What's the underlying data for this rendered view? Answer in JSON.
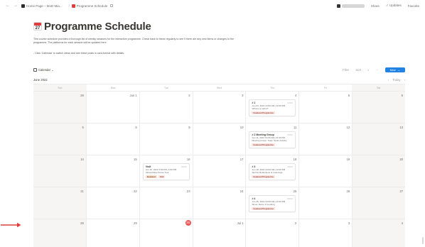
{
  "topbar": {
    "back": "←",
    "forward": "→",
    "crumbs": [
      {
        "label": "Home Page – MoD Mia...",
        "icon_color": "#2b2b2b"
      },
      {
        "label": "Programme Schedule",
        "icon_color": "#e03e3e"
      }
    ],
    "share": "Share",
    "updates": "✓ Updates",
    "favorite": "Favorite"
  },
  "page": {
    "title": "Programme Schedule",
    "icon_day": "27",
    "description": "This course schedule provides a thorough list of weekly sessions for the interactive programme. Check back to these regularly to see if there are any new items or changes to the programme. The platforms for each session will be updated here.",
    "tip": "- Click 'Calendar' to switch views and see these posts in card-format with details."
  },
  "view": {
    "tab_label": "Calendar ⌄",
    "filter": "Filter",
    "sort": "Sort",
    "search": "⌕",
    "more": "···",
    "new_button": "New",
    "new_chevron": "⌄"
  },
  "calendar": {
    "month_label": "June 2022",
    "prev": "‹",
    "today": "Today",
    "next": "›",
    "weekdays": [
      "Sun",
      "Mon",
      "Tue",
      "Wed",
      "Thu",
      "Fri",
      "Sat"
    ],
    "weeks": [
      [
        {
          "num": "29",
          "weekend": true
        },
        {
          "num": "Jun 1",
          "weekend": false
        },
        {
          "num": "2",
          "weekend": false
        },
        {
          "num": "3",
          "weekend": false
        },
        {
          "num": "4",
          "weekend": false,
          "event": {
            "title": "# 1",
            "line1": "Jun 04, 2022 10:00 AM–12:00 PM",
            "line2": "What is a sprint?",
            "tags": [
              {
                "label": "Featured Programme",
                "color": "red"
              }
            ]
          }
        },
        {
          "num": "5",
          "weekend": false
        },
        {
          "num": "6",
          "weekend": true
        }
      ],
      [
        {
          "num": "6",
          "weekend": true
        },
        {
          "num": "8",
          "weekend": false
        },
        {
          "num": "9",
          "weekend": false
        },
        {
          "num": "10",
          "weekend": false
        },
        {
          "num": "11",
          "weekend": false,
          "event": {
            "title": "# 2 Meeting Group",
            "line1": "Jun 11, 2022 10:00 AM–12:00 PM",
            "line2": "Meeting Group: Team Sprint Activity",
            "tags": [
              {
                "label": "Featured Programme",
                "color": "red"
              }
            ]
          }
        },
        {
          "num": "12",
          "weekend": false
        },
        {
          "num": "13",
          "weekend": true
        }
      ],
      [
        {
          "num": "14",
          "weekend": true
        },
        {
          "num": "15",
          "weekend": false
        },
        {
          "num": "16",
          "weekend": false,
          "event": {
            "title": "Visit",
            "line1": "Jun 16, 2022 2:00 PM–4:00 PM",
            "line2": "Virtual Data House Tour",
            "tags": [
              {
                "label": "Featured",
                "color": "orange"
              },
              {
                "label": "Visit",
                "color": "red"
              }
            ]
          }
        },
        {
          "num": "17",
          "weekend": false
        },
        {
          "num": "18",
          "weekend": false,
          "event": {
            "title": "# 3",
            "line1": "Jun 18, 2022 10:00 AM–12:00 PM",
            "line2": "Sprints Reflections & Learnings",
            "tags": [
              {
                "label": "Featured Programme",
                "color": "red"
              }
            ]
          }
        },
        {
          "num": "19",
          "weekend": false
        },
        {
          "num": "20",
          "weekend": true
        }
      ],
      [
        {
          "num": "21",
          "weekend": true
        },
        {
          "num": "22",
          "weekend": false
        },
        {
          "num": "23",
          "weekend": false
        },
        {
          "num": "24",
          "weekend": false
        },
        {
          "num": "25",
          "weekend": false,
          "event": {
            "title": "# 4",
            "line1": "Jun 25, 2022 10:00 AM–12:00 PM",
            "line2": "Show, Demo & Looking",
            "tags": [
              {
                "label": "Featured Programme",
                "color": "red"
              }
            ]
          }
        },
        {
          "num": "26",
          "weekend": false
        },
        {
          "num": "27",
          "weekend": true
        }
      ],
      [
        {
          "num": "28",
          "weekend": true
        },
        {
          "num": "29",
          "weekend": false
        },
        {
          "num": "30",
          "weekend": false,
          "today": true
        },
        {
          "num": "Jul 1",
          "weekend": false
        },
        {
          "num": "2",
          "weekend": false
        },
        {
          "num": "3",
          "weekend": false
        },
        {
          "num": "4",
          "weekend": true
        }
      ]
    ]
  },
  "colors": {
    "accent": "#2383e2",
    "today": "#eb5757",
    "pointer_arrow": "#e03e3e",
    "tag_red_bg": "#ffe2dd",
    "tag_orange_bg": "#fadec9"
  }
}
